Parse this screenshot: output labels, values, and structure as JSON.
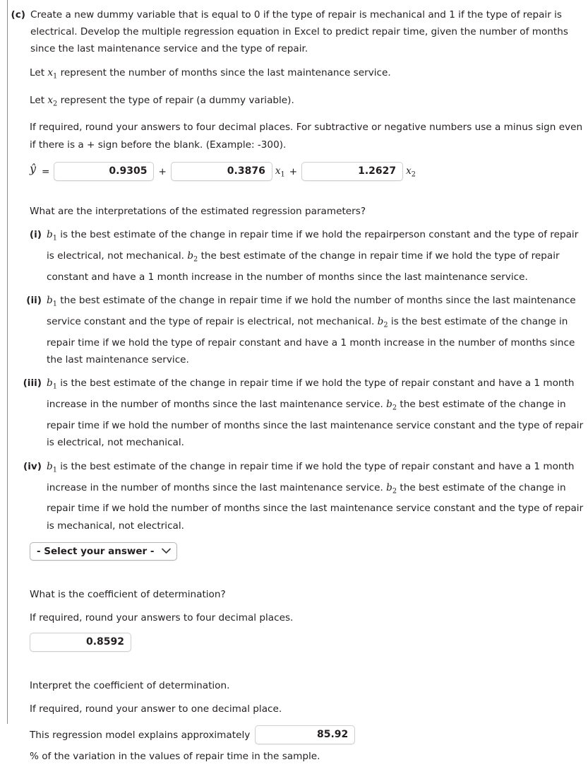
{
  "question": {
    "marker": "(c)",
    "prompt": "Create a new dummy variable that is equal to 0 if the type of repair is mechanical and 1 if the type of repair is electrical. Develop the multiple regression equation in Excel to predict repair time, given the number of months since the last maintenance service and the type of repair.",
    "let_x1": "represent the number of months since the last maintenance service.",
    "let_x1_prefix": "Let",
    "let_x2": "represent the type of repair (a dummy variable).",
    "let_x2_prefix": "Let",
    "rounding_note": "If required, round your answers to four decimal places. For subtractive or negative numbers use a minus sign even if there is a + sign before the blank. (Example: -300)."
  },
  "equation": {
    "lhs_symbol": "ŷ",
    "equals": "=",
    "intercept_value": "0.9305",
    "plus_1": "+",
    "b1_value": "0.3876",
    "x1_label": "x1",
    "plus_2": "+",
    "b2_value": "1.2627",
    "x2_label": "x2"
  },
  "interpretation": {
    "prompt": "What are the interpretations of the estimated regression parameters?",
    "options": [
      {
        "marker": "(i)",
        "text_parts": [
          "b1",
          " is the best estimate of the change in repair time if we hold the repairperson constant and the type of repair is electrical, not mechanical. ",
          "b2",
          " the best estimate of the change in repair time if we hold the type of repair constant and have a 1 month increase in the number of months since the last maintenance service."
        ]
      },
      {
        "marker": "(ii)",
        "text_parts": [
          "b1",
          " the best estimate of the change in repair time if we hold the number of months since the last maintenance service constant and the type of repair is electrical, not mechanical. ",
          "b2",
          " is the best estimate of the change in repair time if we hold the type of repair constant and have a 1 month increase in the number of months since the last maintenance service."
        ]
      },
      {
        "marker": "(iii)",
        "text_parts": [
          "b1",
          " is the best estimate of the change in repair time if we hold the type of repair constant and have a 1 month increase in the number of months since the last maintenance service. ",
          "b2",
          " the best estimate of the change in repair time if we hold the number of months since the last maintenance service constant and the type of repair is electrical, not mechanical."
        ]
      },
      {
        "marker": "(iv)",
        "text_parts": [
          "b1",
          " is the best estimate of the change in repair time if we hold the type of repair constant and have a 1 month increase in the number of months since the last maintenance service. ",
          "b2",
          " the best estimate of the change in repair time if we hold the number of months since the last maintenance service constant and the type of repair is mechanical, not electrical."
        ]
      }
    ],
    "select_placeholder": "- Select your answer -",
    "select_icon": "chevron-down-icon"
  },
  "determination": {
    "prompt": "What is the coefficient of determination?",
    "rounding_note": "If required, round your answers to four decimal places.",
    "value": "0.8592"
  },
  "interpret_determination": {
    "prompt": "Interpret the coefficient of determination.",
    "rounding_note": "If required, round your answer to one decimal place.",
    "sentence_prefix": "This regression model explains approximately",
    "value": "85.92",
    "sentence_suffix": "% of the variation in the values of repair time in the sample."
  }
}
